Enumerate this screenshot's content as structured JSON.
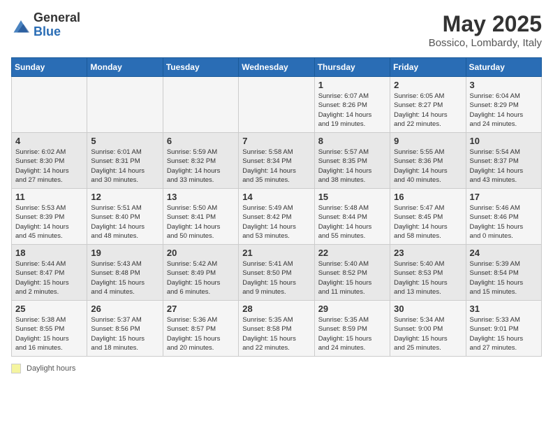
{
  "header": {
    "logo_general": "General",
    "logo_blue": "Blue",
    "title": "May 2025",
    "subtitle": "Bossico, Lombardy, Italy"
  },
  "weekdays": [
    "Sunday",
    "Monday",
    "Tuesday",
    "Wednesday",
    "Thursday",
    "Friday",
    "Saturday"
  ],
  "footer": {
    "daylight_label": "Daylight hours"
  },
  "weeks": [
    [
      {
        "day": "",
        "info": ""
      },
      {
        "day": "",
        "info": ""
      },
      {
        "day": "",
        "info": ""
      },
      {
        "day": "",
        "info": ""
      },
      {
        "day": "1",
        "info": "Sunrise: 6:07 AM\nSunset: 8:26 PM\nDaylight: 14 hours\nand 19 minutes."
      },
      {
        "day": "2",
        "info": "Sunrise: 6:05 AM\nSunset: 8:27 PM\nDaylight: 14 hours\nand 22 minutes."
      },
      {
        "day": "3",
        "info": "Sunrise: 6:04 AM\nSunset: 8:29 PM\nDaylight: 14 hours\nand 24 minutes."
      }
    ],
    [
      {
        "day": "4",
        "info": "Sunrise: 6:02 AM\nSunset: 8:30 PM\nDaylight: 14 hours\nand 27 minutes."
      },
      {
        "day": "5",
        "info": "Sunrise: 6:01 AM\nSunset: 8:31 PM\nDaylight: 14 hours\nand 30 minutes."
      },
      {
        "day": "6",
        "info": "Sunrise: 5:59 AM\nSunset: 8:32 PM\nDaylight: 14 hours\nand 33 minutes."
      },
      {
        "day": "7",
        "info": "Sunrise: 5:58 AM\nSunset: 8:34 PM\nDaylight: 14 hours\nand 35 minutes."
      },
      {
        "day": "8",
        "info": "Sunrise: 5:57 AM\nSunset: 8:35 PM\nDaylight: 14 hours\nand 38 minutes."
      },
      {
        "day": "9",
        "info": "Sunrise: 5:55 AM\nSunset: 8:36 PM\nDaylight: 14 hours\nand 40 minutes."
      },
      {
        "day": "10",
        "info": "Sunrise: 5:54 AM\nSunset: 8:37 PM\nDaylight: 14 hours\nand 43 minutes."
      }
    ],
    [
      {
        "day": "11",
        "info": "Sunrise: 5:53 AM\nSunset: 8:39 PM\nDaylight: 14 hours\nand 45 minutes."
      },
      {
        "day": "12",
        "info": "Sunrise: 5:51 AM\nSunset: 8:40 PM\nDaylight: 14 hours\nand 48 minutes."
      },
      {
        "day": "13",
        "info": "Sunrise: 5:50 AM\nSunset: 8:41 PM\nDaylight: 14 hours\nand 50 minutes."
      },
      {
        "day": "14",
        "info": "Sunrise: 5:49 AM\nSunset: 8:42 PM\nDaylight: 14 hours\nand 53 minutes."
      },
      {
        "day": "15",
        "info": "Sunrise: 5:48 AM\nSunset: 8:44 PM\nDaylight: 14 hours\nand 55 minutes."
      },
      {
        "day": "16",
        "info": "Sunrise: 5:47 AM\nSunset: 8:45 PM\nDaylight: 14 hours\nand 58 minutes."
      },
      {
        "day": "17",
        "info": "Sunrise: 5:46 AM\nSunset: 8:46 PM\nDaylight: 15 hours\nand 0 minutes."
      }
    ],
    [
      {
        "day": "18",
        "info": "Sunrise: 5:44 AM\nSunset: 8:47 PM\nDaylight: 15 hours\nand 2 minutes."
      },
      {
        "day": "19",
        "info": "Sunrise: 5:43 AM\nSunset: 8:48 PM\nDaylight: 15 hours\nand 4 minutes."
      },
      {
        "day": "20",
        "info": "Sunrise: 5:42 AM\nSunset: 8:49 PM\nDaylight: 15 hours\nand 6 minutes."
      },
      {
        "day": "21",
        "info": "Sunrise: 5:41 AM\nSunset: 8:50 PM\nDaylight: 15 hours\nand 9 minutes."
      },
      {
        "day": "22",
        "info": "Sunrise: 5:40 AM\nSunset: 8:52 PM\nDaylight: 15 hours\nand 11 minutes."
      },
      {
        "day": "23",
        "info": "Sunrise: 5:40 AM\nSunset: 8:53 PM\nDaylight: 15 hours\nand 13 minutes."
      },
      {
        "day": "24",
        "info": "Sunrise: 5:39 AM\nSunset: 8:54 PM\nDaylight: 15 hours\nand 15 minutes."
      }
    ],
    [
      {
        "day": "25",
        "info": "Sunrise: 5:38 AM\nSunset: 8:55 PM\nDaylight: 15 hours\nand 16 minutes."
      },
      {
        "day": "26",
        "info": "Sunrise: 5:37 AM\nSunset: 8:56 PM\nDaylight: 15 hours\nand 18 minutes."
      },
      {
        "day": "27",
        "info": "Sunrise: 5:36 AM\nSunset: 8:57 PM\nDaylight: 15 hours\nand 20 minutes."
      },
      {
        "day": "28",
        "info": "Sunrise: 5:35 AM\nSunset: 8:58 PM\nDaylight: 15 hours\nand 22 minutes."
      },
      {
        "day": "29",
        "info": "Sunrise: 5:35 AM\nSunset: 8:59 PM\nDaylight: 15 hours\nand 24 minutes."
      },
      {
        "day": "30",
        "info": "Sunrise: 5:34 AM\nSunset: 9:00 PM\nDaylight: 15 hours\nand 25 minutes."
      },
      {
        "day": "31",
        "info": "Sunrise: 5:33 AM\nSunset: 9:01 PM\nDaylight: 15 hours\nand 27 minutes."
      }
    ]
  ]
}
